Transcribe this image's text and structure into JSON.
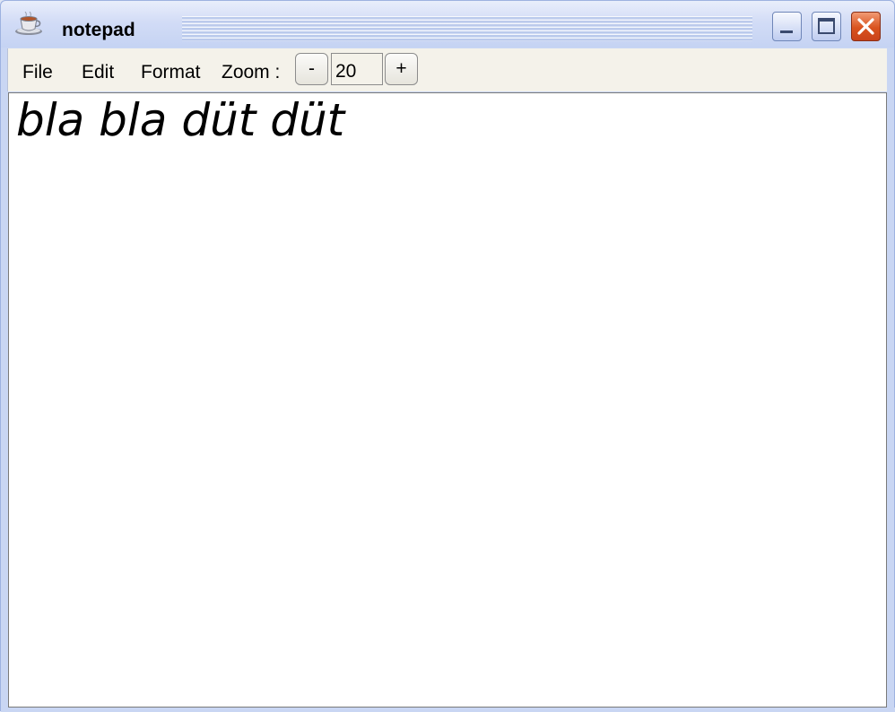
{
  "window": {
    "title": "notepad",
    "app_icon": "teacup-icon",
    "controls": {
      "minimize_icon": "minimize-icon",
      "maximize_icon": "maximize-icon",
      "close_icon": "close-icon"
    }
  },
  "menubar": {
    "items": [
      "File",
      "Edit",
      "Format"
    ],
    "zoom_label": "Zoom :",
    "zoom_minus_label": "-",
    "zoom_value": "20",
    "zoom_plus_label": "+"
  },
  "editor": {
    "content": "bla bla düt düt"
  },
  "colors": {
    "title_gradient_top": "#e9eefb",
    "title_gradient_bottom": "#c5d3f3",
    "menubar_bg": "#f4f2ea",
    "close_button": "#d9531f",
    "editor_bg": "#ffffff"
  }
}
